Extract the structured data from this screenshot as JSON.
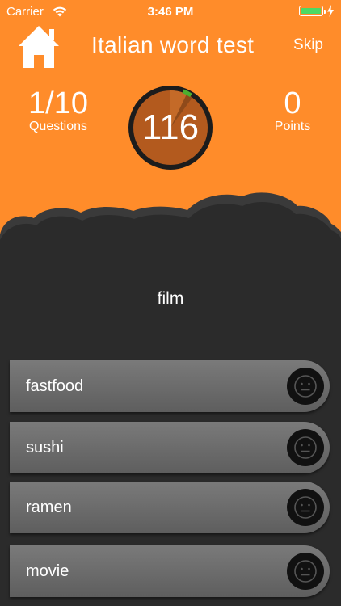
{
  "status_bar": {
    "carrier": "Carrier",
    "time": "3:46 PM"
  },
  "header": {
    "title": "Italian word test",
    "skip_label": "Skip"
  },
  "stats": {
    "questions_value": "1/10",
    "questions_label": "Questions",
    "points_value": "0",
    "points_label": "Points"
  },
  "timer": {
    "value": "116"
  },
  "question": {
    "word": "film"
  },
  "answers": [
    {
      "label": "fastfood"
    },
    {
      "label": "sushi"
    },
    {
      "label": "ramen"
    },
    {
      "label": "movie"
    }
  ],
  "colors": {
    "accent": "#ff8c2a",
    "background": "#2b2b2b",
    "battery": "#4cd964",
    "timer_fill": "#b35a1e",
    "timer_progress": "#4caf2f"
  },
  "icons": {
    "home": "home-icon",
    "wifi": "wifi-icon",
    "battery": "battery-icon",
    "charging": "bolt-icon",
    "answer_state": "neutral-face-icon"
  }
}
